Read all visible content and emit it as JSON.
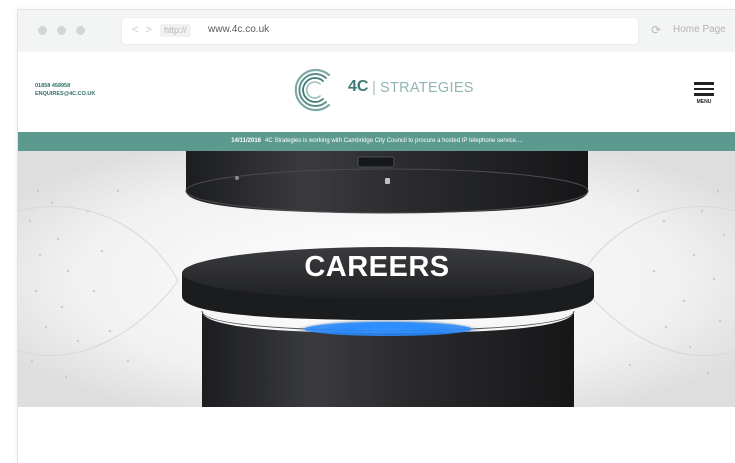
{
  "browser": {
    "nav_arrows": "< >",
    "protocol": "http://",
    "url": "www.4c.co.uk",
    "home_label": "Home Page",
    "reload_icon": "reload-icon"
  },
  "site": {
    "phone": "01858 458958",
    "email": "ENQUIRES@4C.CO.UK",
    "logo_4c": "4C",
    "logo_divider": "|",
    "logo_strategies": "STRATEGIES",
    "menu_label": "MENU"
  },
  "ticker": {
    "date": "14/11/2016",
    "text": "4C Strategies is working with Cambridge City Council to procure a hosted IP telephone service...."
  },
  "hero": {
    "heading": "CAREERS"
  },
  "colors": {
    "brand_teal": "#5c9a8f",
    "logo_teal": "#3e7a75",
    "device_dark": "#2a2b2d",
    "glow_blue": "#1f8fff"
  }
}
